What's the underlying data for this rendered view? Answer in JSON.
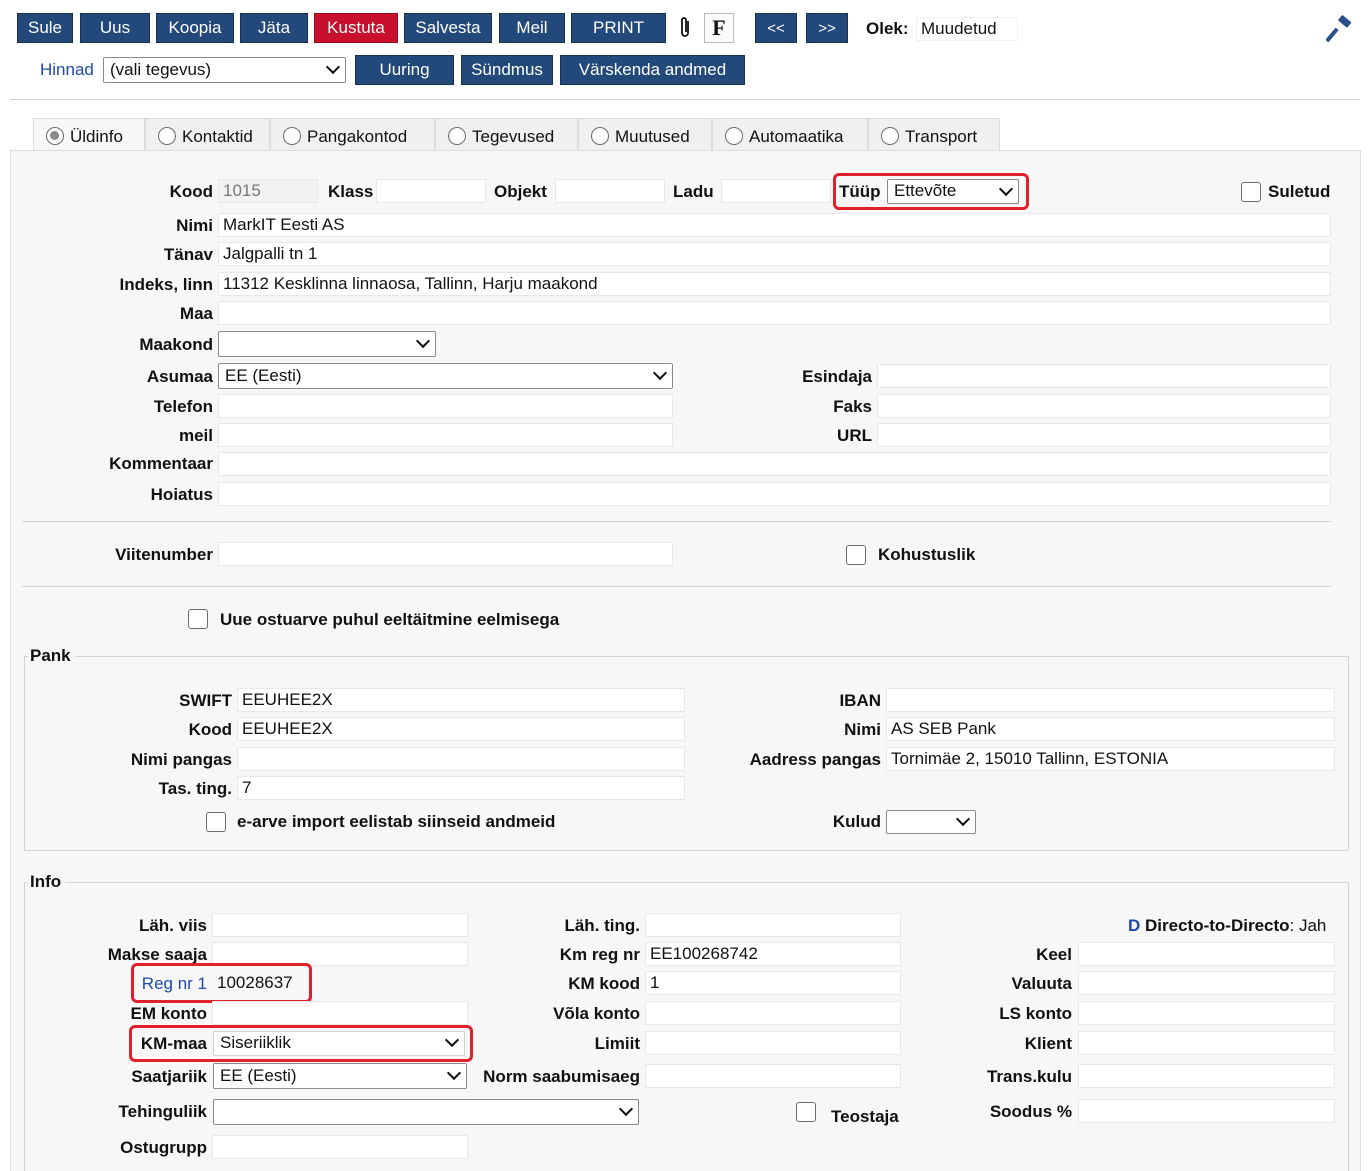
{
  "toolbar": {
    "sule": "Sule",
    "uus": "Uus",
    "koopia": "Koopia",
    "jata": "Jäta",
    "kustuta": "Kustuta",
    "salvesta": "Salvesta",
    "meil": "Meil",
    "print": "PRINT",
    "f_icon": "F",
    "prev": "<<",
    "next": ">>",
    "olek_label": "Olek:",
    "olek_value": "Muudetud"
  },
  "toolbar2": {
    "hinnad": "Hinnad",
    "action_select": "(vali tegevus)",
    "uuring": "Uuring",
    "sundmus": "Sündmus",
    "varskenda": "Värskenda andmed"
  },
  "tabs": [
    "Üldinfo",
    "Kontaktid",
    "Pangakontod",
    "Tegevused",
    "Muutused",
    "Automaatika",
    "Transport"
  ],
  "general": {
    "kood_label": "Kood",
    "kood_value": "1015",
    "klass_label": "Klass",
    "klass_value": "",
    "objekt_label": "Objekt",
    "objekt_value": "",
    "ladu_label": "Ladu",
    "ladu_value": "",
    "tyyp_label": "Tüüp",
    "tyyp_value": "Ettevõte",
    "suletud_label": "Suletud",
    "nimi_label": "Nimi",
    "nimi_value": "MarkIT Eesti AS",
    "tanav_label": "Tänav",
    "tanav_value": "Jalgpalli tn 1",
    "indeks_label": "Indeks, linn",
    "indeks_value": "11312 Kesklinna linnaosa, Tallinn, Harju maakond",
    "maa_label": "Maa",
    "maa_value": "",
    "maakond_label": "Maakond",
    "maakond_value": "",
    "asumaa_label": "Asumaa",
    "asumaa_value": "EE (Eesti)",
    "esindaja_label": "Esindaja",
    "esindaja_value": "",
    "telefon_label": "Telefon",
    "telefon_value": "",
    "faks_label": "Faks",
    "faks_value": "",
    "meil_label": "meil",
    "meil_value": "",
    "url_label": "URL",
    "url_value": "",
    "kommentaar_label": "Kommentaar",
    "kommentaar_value": "",
    "hoiatus_label": "Hoiatus",
    "hoiatus_value": "",
    "viitenumber_label": "Viitenumber",
    "viitenumber_value": "",
    "kohustuslik_label": "Kohustuslik",
    "uue_ostuarve_label": "Uue ostuarve puhul eeltäitmine eelmisega"
  },
  "pank": {
    "title": "Pank",
    "swift_label": "SWIFT",
    "swift_value": "EEUHEE2X",
    "kood_label": "Kood",
    "kood_value": "EEUHEE2X",
    "nimi_pangas_label": "Nimi pangas",
    "nimi_pangas_value": "",
    "tas_ting_label": "Tas. ting.",
    "tas_ting_value": "7",
    "earve_label": "e-arve import eelistab siinseid andmeid",
    "iban_label": "IBAN",
    "iban_value": "",
    "nimi_label": "Nimi",
    "nimi_value": "AS SEB Pank",
    "aadress_label": "Aadress pangas",
    "aadress_value": "Tornimäe 2, 15010 Tallinn, ESTONIA",
    "kulud_label": "Kulud",
    "kulud_value": ""
  },
  "info": {
    "title": "Info",
    "lah_viis_label": "Läh. viis",
    "lah_viis_value": "",
    "makse_saaja_label": "Makse saaja",
    "makse_saaja_value": "",
    "reg_nr_label": "Reg nr 1",
    "reg_nr_value": "10028637",
    "em_konto_label": "EM konto",
    "em_konto_value": "",
    "km_maa_label": "KM-maa",
    "km_maa_value": "Siseriiklik",
    "saatjariik_label": "Saatjariik",
    "saatjariik_value": "EE (Eesti)",
    "tehinguliik_label": "Tehinguliik",
    "tehinguliik_value": "",
    "ostugrupp_label": "Ostugrupp",
    "ostugrupp_value": "",
    "lah_ting_label": "Läh. ting.",
    "lah_ting_value": "",
    "km_reg_label": "Km reg nr",
    "km_reg_value": "EE100268742",
    "km_kood_label": "KM kood",
    "km_kood_value": "1",
    "vola_label": "Võla konto",
    "vola_value": "",
    "limiit_label": "Limiit",
    "limiit_value": "",
    "norm_label": "Norm saabumisaeg",
    "norm_value": "",
    "teostaja_label": "Teostaja",
    "d2d_logo": "D",
    "d2d_label": "Directo-to-Directo",
    "d2d_value": ": Jah",
    "keel_label": "Keel",
    "keel_value": "",
    "valuuta_label": "Valuuta",
    "valuuta_value": "",
    "ls_label": "LS konto",
    "ls_value": "",
    "klient_label": "Klient",
    "klient_value": "",
    "trans_label": "Trans.kulu",
    "trans_value": "",
    "soodus_label": "Soodus %",
    "soodus_value": ""
  }
}
